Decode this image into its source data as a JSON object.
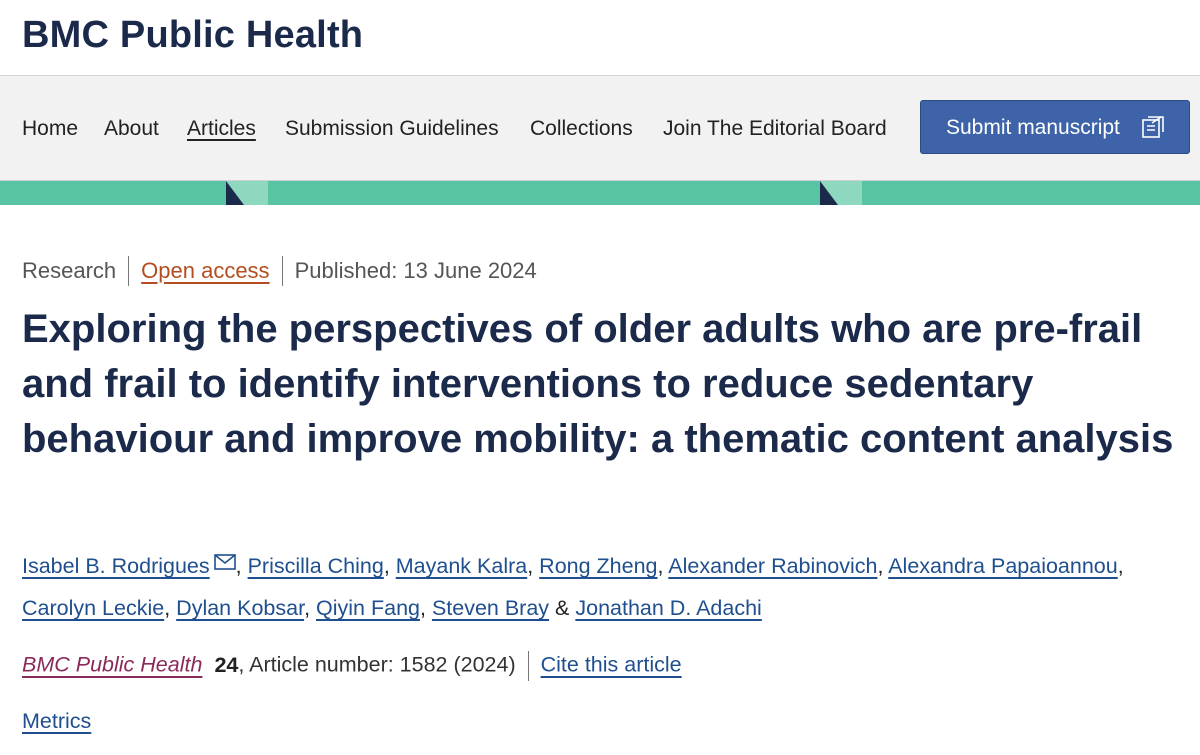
{
  "header": {
    "brand": "BMC Public Health"
  },
  "nav": {
    "items": [
      {
        "label": "Home"
      },
      {
        "label": "About"
      },
      {
        "label": "Articles"
      },
      {
        "label": "Submission Guidelines"
      },
      {
        "label": "Collections"
      },
      {
        "label": "Join The Editorial Board"
      }
    ],
    "submit_label": "Submit manuscript",
    "submit_icon": "external-form-icon"
  },
  "colors": {
    "brand": "#1b2a4a",
    "accent_band": "#58c4a4",
    "button": "#3e63a8",
    "link": "#1f4f8f",
    "open_access": "#b44e20",
    "journal": "#8a2a58"
  },
  "article": {
    "type": "Research",
    "access": "Open access",
    "published": "Published: 13 June 2024",
    "title": "Exploring the perspectives of older adults who are pre-frail and frail to identify interventions to reduce sedentary behaviour and improve mobility: a thematic content analysis",
    "authors": [
      "Isabel B. Rodrigues",
      "Priscilla Ching",
      "Mayank Kalra",
      "Rong Zheng",
      "Alexander Rabinovich",
      "Alexandra Papaioannou",
      "Carolyn Leckie",
      "Dylan Kobsar",
      "Qiyin Fang",
      "Steven Bray",
      "Jonathan D. Adachi"
    ],
    "author_separator": ", ",
    "last_separator": " & ",
    "corresponding_icon": "mail-icon",
    "journal": "BMC Public Health",
    "volume": "24",
    "article_number": ", Article number: 1582 (2024)",
    "cite_label": "Cite this article",
    "metrics_label": "Metrics"
  }
}
